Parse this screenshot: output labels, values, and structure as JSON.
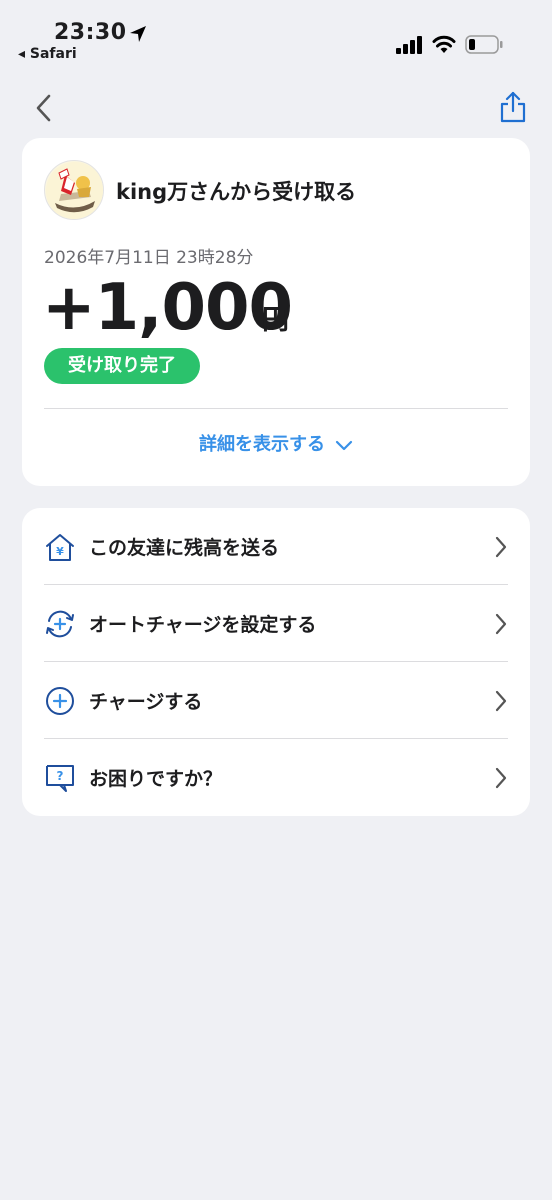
{
  "status_bar": {
    "time": "23:30",
    "back_app": "◂ Safari"
  },
  "navbar": {
    "back_icon": "chevron-left-icon",
    "share_icon": "share-icon"
  },
  "transaction": {
    "sender": "king万さんから受け取る",
    "date": "2026年7月11日 23時28分",
    "amount": "+1,000",
    "currency": "円",
    "status": "受け取り完了",
    "details_label": "詳細を表示する"
  },
  "actions": [
    {
      "label": "この友達に残高を送る",
      "icon": "house-yen-icon"
    },
    {
      "label": "オートチャージを設定する",
      "icon": "auto-charge-icon"
    },
    {
      "label": "チャージする",
      "icon": "plus-circle-icon"
    },
    {
      "label": "お困りですか？",
      "icon": "help-bubble-icon"
    }
  ],
  "colors": {
    "accent_blue": "#3891e8",
    "success_green": "#2bc26c",
    "icon_navy": "#1f4e9c",
    "background": "#eff0f4"
  }
}
